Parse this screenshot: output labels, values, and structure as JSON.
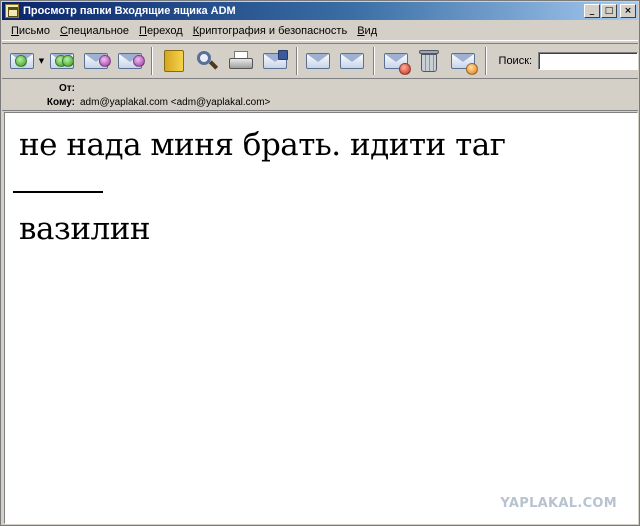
{
  "window": {
    "title": "Просмотр папки Входящие ящика ADM",
    "controls": {
      "minimize": "_",
      "maximize": "□",
      "close": "×"
    }
  },
  "menu": {
    "items": [
      "Письмо",
      "Специальное",
      "Переход",
      "Криптография и безопасность",
      "Вид"
    ]
  },
  "toolbar": {
    "buttons": [
      {
        "icon": "get-mail-icon"
      },
      {
        "icon": "reply-all-icon"
      },
      {
        "icon": "reply-icon"
      },
      {
        "icon": "forward-icon"
      },
      {
        "icon": "address-book-icon"
      },
      {
        "icon": "find-icon"
      },
      {
        "icon": "print-icon"
      },
      {
        "icon": "save-icon"
      },
      {
        "icon": "previous-message-icon"
      },
      {
        "icon": "next-message-icon"
      },
      {
        "icon": "mark-read-icon"
      },
      {
        "icon": "trash-icon"
      },
      {
        "icon": "delete-message-icon"
      }
    ],
    "search_label": "Поиск:",
    "search_value": ""
  },
  "headers": {
    "from_label": "От:",
    "from_value": "",
    "to_label": "Кому:",
    "to_value": "adm@yaplakal.com <adm@yaplakal.com>"
  },
  "message": {
    "line1": "не нада миня брать. идити таг",
    "line2": "вазилин"
  },
  "watermark": "YAPLAKAL.COM"
}
